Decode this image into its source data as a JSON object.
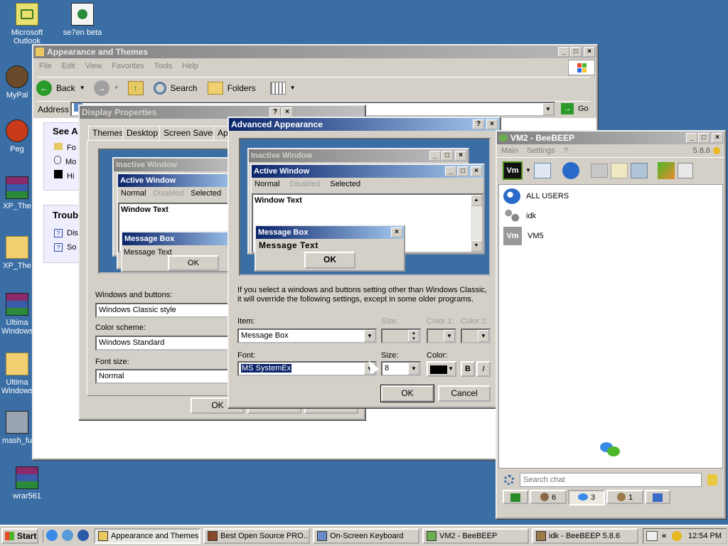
{
  "colors": {
    "desktop": "#3a6ea5",
    "title_active": "#0a246a",
    "title_inactive": "#808080",
    "bee_accent": "#4a8f1a"
  },
  "desktop": {
    "icons": [
      {
        "label": "Microsoft Outlook",
        "icon": "outlook-icon"
      },
      {
        "label": "se7en beta",
        "icon": "file-icon"
      },
      {
        "label": "MyPal",
        "icon": "mypal-icon"
      },
      {
        "label": "Peg",
        "icon": "peg-icon"
      },
      {
        "label": "XP_The",
        "icon": "archive-icon"
      },
      {
        "label": "XP_The",
        "icon": "folder-icon"
      },
      {
        "label": "Ultima Windows",
        "icon": "archive-icon"
      },
      {
        "label": "Ultima Windows",
        "icon": "folder-icon"
      },
      {
        "label": "mash_fu",
        "icon": "shortcut-icon"
      },
      {
        "label": "wrar561",
        "icon": "archive-icon"
      }
    ]
  },
  "explorer": {
    "title": "Appearance and Themes",
    "menu": [
      "File",
      "Edit",
      "View",
      "Favorites",
      "Tools",
      "Help"
    ],
    "toolbar": {
      "back": "Back",
      "search": "Search",
      "folders": "Folders"
    },
    "address_label": "Address",
    "go": "Go",
    "see_also": {
      "header": "See Al",
      "items": [
        "Fo",
        "Mo",
        "Hi"
      ]
    },
    "troubleshooters": {
      "header": "Troubl",
      "items": [
        "Dis",
        "So"
      ]
    }
  },
  "display_props": {
    "title": "Display Properties",
    "tabs": [
      "Themes",
      "Desktop",
      "Screen Saver",
      "Ap"
    ],
    "preview": {
      "inactive": "Inactive Window",
      "active": "Active Window",
      "menu": [
        "Normal",
        "Disabled",
        "Selected"
      ],
      "window_text": "Window Text",
      "msgbox_title": "Message Box",
      "msgbox_text": "Message Text",
      "ok": "OK"
    },
    "windows_buttons_label": "Windows and buttons:",
    "windows_buttons_value": "Windows Classic style",
    "color_scheme_label": "Color scheme:",
    "color_scheme_value": "Windows Standard",
    "font_size_label": "Font size:",
    "font_size_value": "Normal",
    "ok": "OK"
  },
  "advanced": {
    "title": "Advanced Appearance",
    "preview": {
      "inactive": "Inactive Window",
      "active": "Active Window",
      "menu": [
        "Normal",
        "Disabled",
        "Selected"
      ],
      "window_text": "Window Text",
      "msgbox_title": "Message Box",
      "msgbox_text": "Message Text",
      "ok": "OK"
    },
    "info": "If you select a windows and buttons setting other than Windows Classic, it will override the following settings, except in some older programs.",
    "item_label": "Item:",
    "item_value": "Message Box",
    "size_label": "Size:",
    "color1_label": "Color 1:",
    "color2_label": "Color 2:",
    "font_label": "Font:",
    "font_value": "MS SystemEx",
    "font_size_label": "Size:",
    "font_size_value": "8",
    "font_color_label": "Color:",
    "bold": "B",
    "italic": "I",
    "ok": "OK",
    "cancel": "Cancel"
  },
  "beebeep": {
    "title": "VM2 - BeeBEEP",
    "menu": [
      "Main",
      "Settings",
      "?"
    ],
    "version": "5.8.6",
    "users": [
      {
        "name": "ALL USERS",
        "icon": "all-users-icon"
      },
      {
        "name": "idk",
        "icon": "group-icon"
      },
      {
        "name": "VM5",
        "icon": "vm-avatar-icon"
      }
    ],
    "search_placeholder": "Search chat",
    "tabs": [
      {
        "count": ""
      },
      {
        "count": "6"
      },
      {
        "count": "3"
      },
      {
        "count": "1"
      },
      {
        "count": ""
      }
    ]
  },
  "taskbar": {
    "start": "Start",
    "tasks": [
      "Appearance and Themes",
      "Best Open Source PRO...",
      "On-Screen Keyboard",
      "VM2 - BeeBEEP",
      "idk - BeeBEEP 5.8.6"
    ],
    "tray_arrows": "«",
    "clock": "12:54 PM"
  }
}
